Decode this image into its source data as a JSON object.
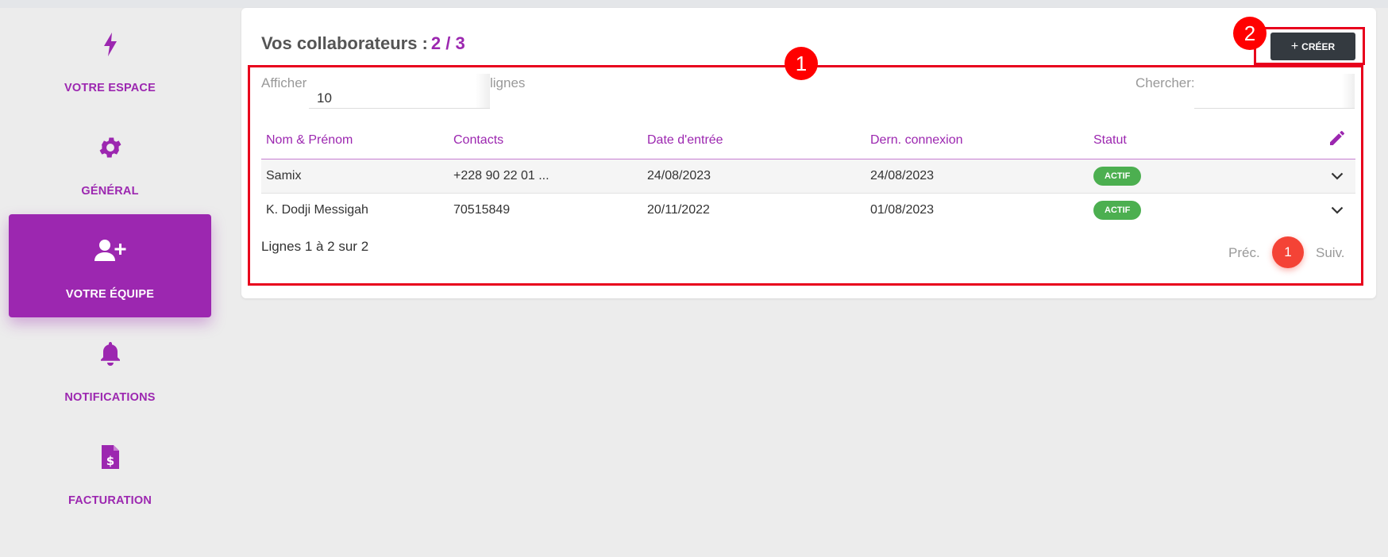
{
  "sidebar": {
    "items": [
      {
        "label": "VOTRE ESPACE",
        "icon": "lightning-bolt-icon"
      },
      {
        "label": "GÉNÉRAL",
        "icon": "gear-icon"
      },
      {
        "label": "VOTRE ÉQUIPE",
        "icon": "user-plus-icon",
        "active": true
      },
      {
        "label": "NOTIFICATIONS",
        "icon": "bell-icon"
      },
      {
        "label": "FACTURATION",
        "icon": "invoice-dollar-icon"
      }
    ]
  },
  "header": {
    "title": "Vos collaborateurs :",
    "count": "2 / 3",
    "create_label": "CRÉER"
  },
  "annotations": {
    "one": "1",
    "two": "2"
  },
  "controls": {
    "show_label": "Afficher",
    "page_length": "10",
    "lines_label": "lignes",
    "search_label": "Chercher:",
    "search_value": ""
  },
  "table": {
    "columns": [
      "Nom & Prénom",
      "Contacts",
      "Date d'entrée",
      "Dern. connexion",
      "Statut"
    ],
    "rows": [
      {
        "name": "Samix",
        "contact": "+228 90 22 01 ...",
        "entry": "24/08/2023",
        "last_login": "24/08/2023",
        "status": "ACTIF"
      },
      {
        "name": "K. Dodji Messigah",
        "contact": "70515849",
        "entry": "20/11/2022",
        "last_login": "01/08/2023",
        "status": "ACTIF"
      }
    ]
  },
  "footer": {
    "info": "Lignes 1 à 2 sur 2",
    "prev": "Préc.",
    "page": "1",
    "next": "Suiv."
  },
  "colors": {
    "accent": "#9c27b0",
    "active_status": "#4caf50",
    "annotation": "#e8001c",
    "page": "#f44336"
  }
}
